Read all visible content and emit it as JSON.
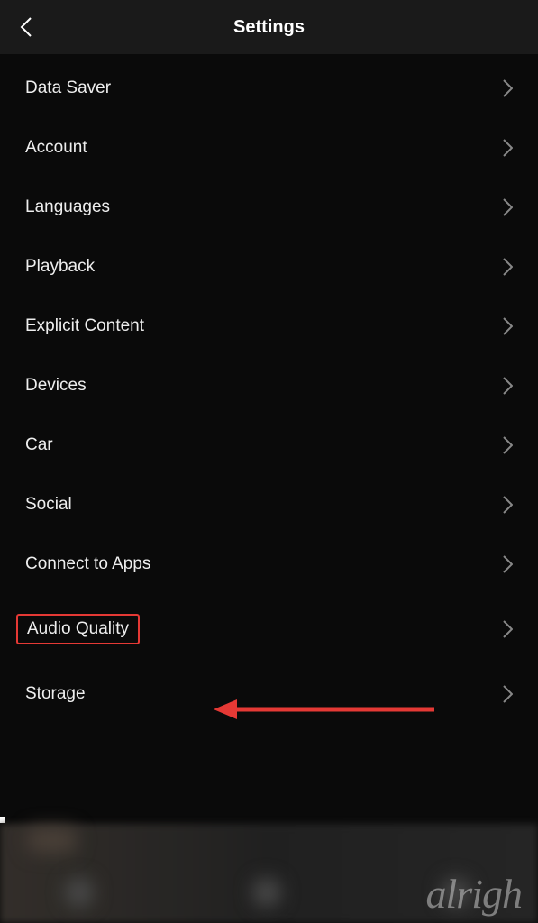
{
  "header": {
    "title": "Settings"
  },
  "settings": {
    "items": [
      {
        "label": "Data Saver",
        "highlighted": false
      },
      {
        "label": "Account",
        "highlighted": false
      },
      {
        "label": "Languages",
        "highlighted": false
      },
      {
        "label": "Playback",
        "highlighted": false
      },
      {
        "label": "Explicit Content",
        "highlighted": false
      },
      {
        "label": "Devices",
        "highlighted": false
      },
      {
        "label": "Car",
        "highlighted": false
      },
      {
        "label": "Social",
        "highlighted": false
      },
      {
        "label": "Connect to Apps",
        "highlighted": false
      },
      {
        "label": "Audio Quality",
        "highlighted": true
      },
      {
        "label": "Storage",
        "highlighted": false
      }
    ]
  },
  "annotation": {
    "highlight_color": "#e53935",
    "arrow_color": "#e53935"
  },
  "watermark": {
    "text": "alrigh"
  }
}
